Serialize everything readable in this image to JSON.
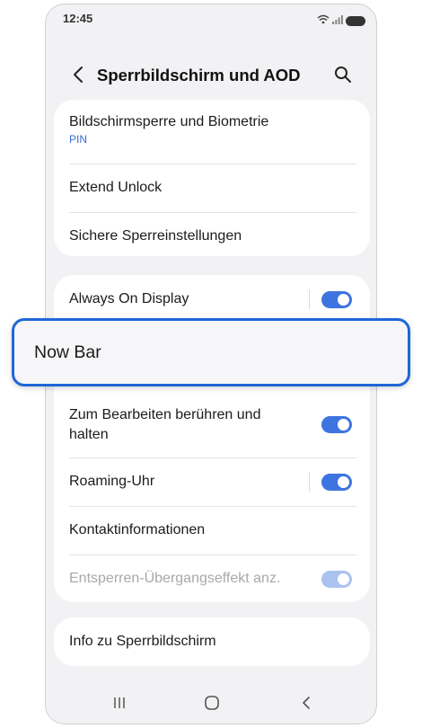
{
  "status_bar": {
    "time": "12:45"
  },
  "header": {
    "title": "Sperrbildschirm und AOD"
  },
  "card1": {
    "items": [
      {
        "label": "Bildschirmsperre und Biometrie",
        "sublabel": "PIN"
      },
      {
        "label": "Extend Unlock"
      },
      {
        "label": "Sichere Sperreinstellungen"
      }
    ]
  },
  "card2": {
    "items": [
      {
        "label": "Always On Display",
        "toggle": true
      },
      {
        "label": "Zum Bearbeiten berühren und halten",
        "toggle": true
      },
      {
        "label": "Roaming-Uhr",
        "toggle": true
      },
      {
        "label": "Kontaktinformationen"
      },
      {
        "label": "Entsperren-Übergangseffekt anz.",
        "toggle": true,
        "disabled": true
      }
    ]
  },
  "highlight": {
    "label": "Now Bar"
  },
  "card3": {
    "items": [
      {
        "label": "Info zu Sperrbildschirm"
      }
    ]
  },
  "colors": {
    "accent": "#3e74e0",
    "highlight_border": "#1f66d8",
    "sublabel": "#3a6fd3"
  },
  "icons": [
    "wifi-icon",
    "signal-icon",
    "battery-icon",
    "back-icon",
    "search-icon",
    "recents-icon",
    "home-icon",
    "nav-back-icon"
  ]
}
